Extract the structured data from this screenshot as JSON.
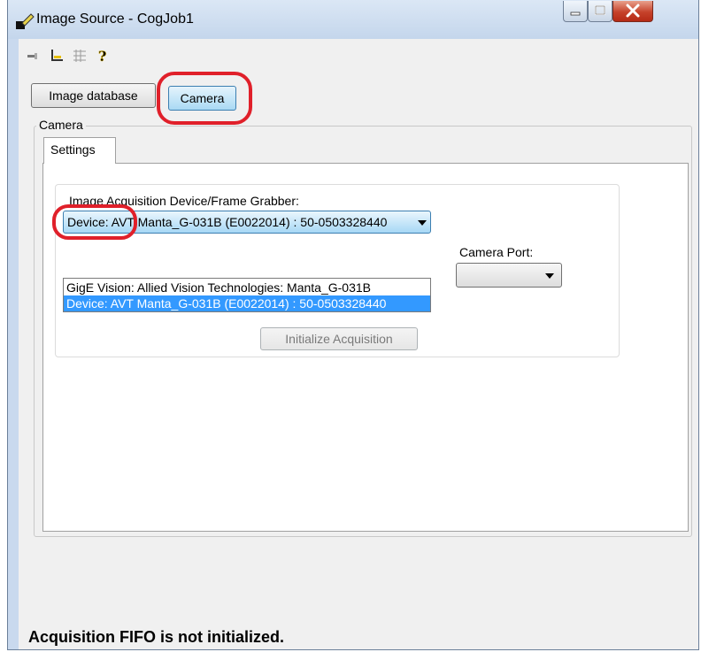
{
  "window": {
    "title": "Image Source - CogJob1",
    "controls": {
      "minimize": "minimize-icon",
      "maximize": "maximize-icon",
      "close": "close-icon"
    }
  },
  "toolbar": {
    "icons": [
      "pin-icon",
      "crop-icon",
      "grid-icon",
      "help-icon"
    ]
  },
  "source_buttons": {
    "image_database": "Image database",
    "camera": "Camera"
  },
  "camera_group": {
    "title": "Camera",
    "tab": "Settings",
    "acquisition_label": "Image Acquisition Device/Frame Grabber:",
    "device_selected": "Device: AVT Manta_G-031B (E0022014) : 50-0503328440",
    "device_options": [
      "GigE Vision: Allied Vision Technologies: Manta_G-031B",
      "Device: AVT Manta_G-031B (E0022014) : 50-0503328440"
    ],
    "camera_port_label": "Camera Port:",
    "camera_port_value": "",
    "initialize_button": "Initialize Acquisition"
  },
  "status": {
    "text": "Acquisition FIFO is not initialized."
  },
  "colors": {
    "highlight": "#e0202a",
    "selection": "#3399ff"
  }
}
